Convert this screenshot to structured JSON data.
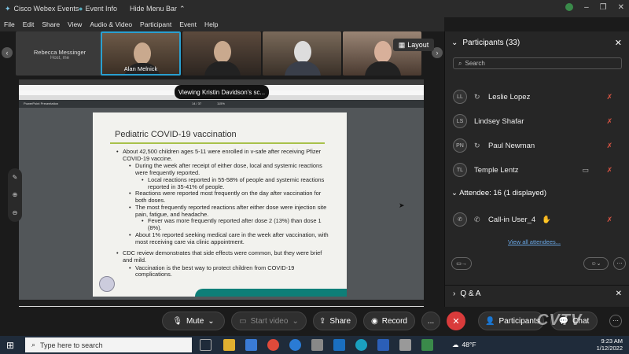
{
  "window": {
    "title": "Cisco Webex Events",
    "event_info": "Event Info",
    "hide_menu_bar": "Hide Menu Bar"
  },
  "menu": [
    "File",
    "Edit",
    "Share",
    "View",
    "Audio & Video",
    "Participant",
    "Event",
    "Help"
  ],
  "videos": {
    "host_name": "Rebecca Messinger",
    "host_role": "Host, me",
    "active_speaker": "Alan Melnick",
    "layout_label": "Layout"
  },
  "share": {
    "viewing_banner": "Viewing Kristin Davidson's sc...",
    "pdf_title": "PowerPoint Presentation",
    "page_indicator": "14 / 37",
    "zoom": "115%"
  },
  "slide": {
    "title": "Pediatric COVID-19 vaccination",
    "bullets": [
      {
        "level": 1,
        "text": "About 42,500 children ages 5-11 were enrolled in v-safe after receiving Pfizer COVID-19 vaccine."
      },
      {
        "level": 2,
        "text": "During the week after receipt of either dose, local and systemic reactions were frequently reported."
      },
      {
        "level": 3,
        "text": "Local reactions reported in 55-58% of people and systemic reactions reported in 35-41% of people."
      },
      {
        "level": 2,
        "text": "Reactions were reported most frequently on the day after vaccination for both doses."
      },
      {
        "level": 2,
        "text": "The most frequently reported reactions after either dose were injection site pain, fatigue, and headache."
      },
      {
        "level": 3,
        "text": "Fever was more frequently reported after dose 2 (13%) than dose 1 (8%)."
      },
      {
        "level": 2,
        "text": "About 1% reported seeking medical care in the week after vaccination, with most receiving care via clinic appointment."
      },
      {
        "level": 0,
        "text": ""
      },
      {
        "level": 1,
        "text": "CDC review demonstrates that side effects were common, but they were brief and mild."
      },
      {
        "level": 2,
        "text": "Vaccination is the best way to protect children from COVID-19 complications."
      }
    ]
  },
  "participants": {
    "header": "Participants (33)",
    "search_placeholder": "Search",
    "list": [
      {
        "initials": "LL",
        "name": "Leslie Lopez",
        "camera": false
      },
      {
        "initials": "LS",
        "name": "Lindsey Shafar",
        "camera": false
      },
      {
        "initials": "PN",
        "name": "Paul Newman",
        "camera": false
      },
      {
        "initials": "TL",
        "name": "Temple Lentz",
        "camera": true
      }
    ],
    "attendee_header": "Attendee: 16 (1 displayed)",
    "attendee": {
      "name": "Call-in User_4"
    },
    "view_all": "View all attendees...",
    "qa_header": "Q & A"
  },
  "controls": {
    "mute": "Mute",
    "start_video": "Start video",
    "share": "Share",
    "record": "Record",
    "more": "...",
    "participants": "Participants",
    "chat": "Chat"
  },
  "watermark": "CVTV",
  "taskbar": {
    "search_placeholder": "Type here to search",
    "temperature": "48°F",
    "time": "9:23 AM",
    "date": "1/12/2022"
  },
  "colors": {
    "accent": "#2aa0d0",
    "end": "#d93b3b",
    "muted_mic": "#d54",
    "slide_rule": "#a8c14a",
    "slide_wave": "#0e7f78"
  }
}
